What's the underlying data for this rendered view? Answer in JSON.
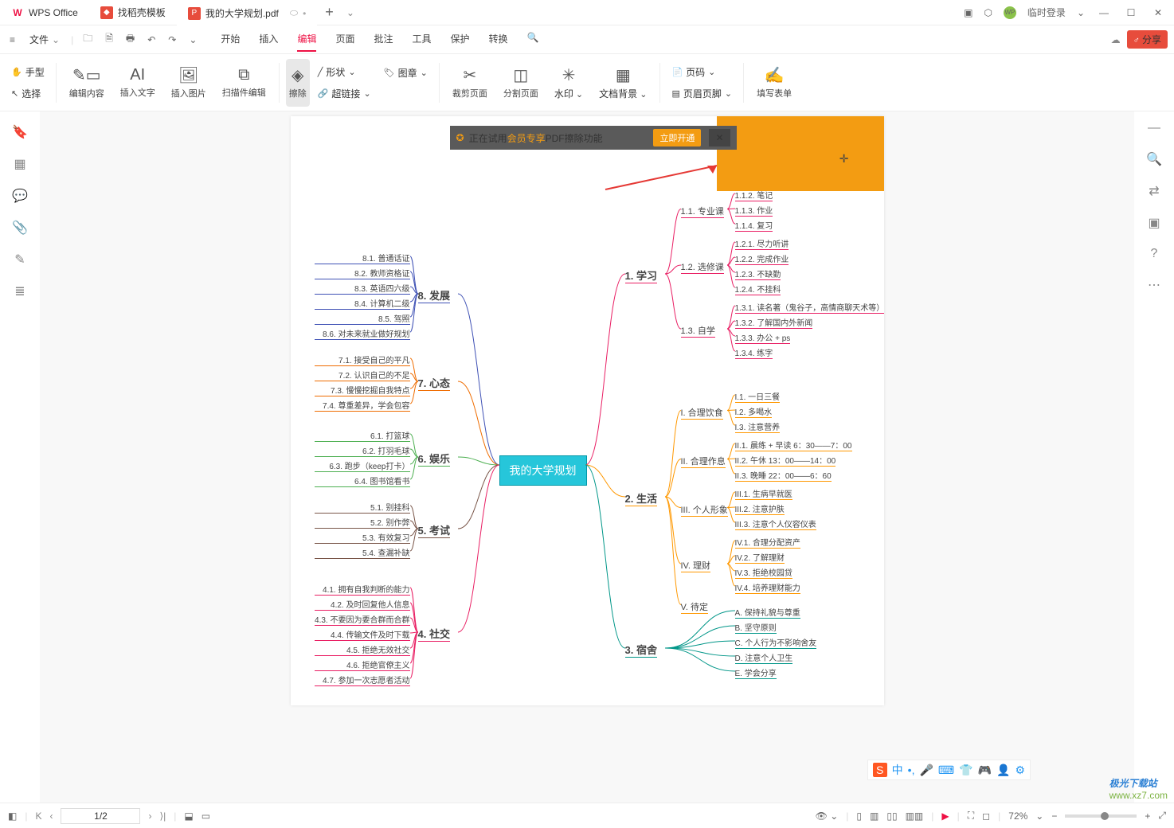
{
  "titlebar": {
    "app_name": "WPS Office",
    "tabs": [
      {
        "label": "找稻壳模板",
        "type": "template"
      },
      {
        "label": "我的大学规划.pdf",
        "type": "pdf"
      }
    ],
    "login_text": "临时登录",
    "avatar_text": "WP"
  },
  "menubar": {
    "file_label": "文件",
    "tabs": [
      "开始",
      "插入",
      "编辑",
      "页面",
      "批注",
      "工具",
      "保护",
      "转换"
    ],
    "active_tab": "编辑",
    "share_label": "分享"
  },
  "ribbon": {
    "hand": "手型",
    "select": "选择",
    "edit_content": "编辑内容",
    "insert_text": "插入文字",
    "insert_image": "插入图片",
    "scan_edit": "扫描件编辑",
    "erase": "擦除",
    "shape": "形状",
    "image": "图章",
    "hyperlink": "超链接",
    "crop_page": "裁剪页面",
    "split_page": "分割页面",
    "watermark": "水印",
    "doc_bg": "文档背景",
    "page_num": "页码",
    "header_footer": "页眉页脚",
    "fill_form": "填写表单"
  },
  "trial": {
    "prefix": "正在试用",
    "highlight": "会员专享",
    "suffix": "PDF擦除功能",
    "button": "立即开通"
  },
  "mindmap": {
    "center": "我的大学规划",
    "right": [
      {
        "label": "1. 学习",
        "children": [
          {
            "label": "1.1. 专业课",
            "leaves": [
              "1.1.2. 笔记",
              "1.1.3. 作业",
              "1.1.4. 复习"
            ]
          },
          {
            "label": "1.2. 选修课",
            "leaves": [
              "1.2.1. 尽力听讲",
              "1.2.2. 完成作业",
              "1.2.3. 不缺勤",
              "1.2.4. 不挂科"
            ]
          },
          {
            "label": "1.3. 自学",
            "leaves": [
              "1.3.1. 读名著（鬼谷子，高情商聊天术等）",
              "1.3.2. 了解国内外新闻",
              "1.3.3. 办公 + ps",
              "1.3.4. 练字"
            ]
          }
        ]
      },
      {
        "label": "2. 生活",
        "children": [
          {
            "label": "I. 合理饮食",
            "leaves": [
              "I.1. 一日三餐",
              "I.2. 多喝水",
              "I.3. 注意营养"
            ]
          },
          {
            "label": "II. 合理作息",
            "leaves": [
              "II.1. 晨练 + 早读 6：30——7：00",
              "II.2. 午休 13：00——14：00",
              "II.3. 晚睡 22：00——6：60"
            ]
          },
          {
            "label": "III. 个人形象",
            "leaves": [
              "III.1. 生病早就医",
              "III.2. 注意护肤",
              "III.3. 注意个人仪容仪表"
            ]
          },
          {
            "label": "IV. 理财",
            "leaves": [
              "IV.1. 合理分配资产",
              "IV.2. 了解理财",
              "IV.3. 拒绝校园贷",
              "IV.4. 培养理财能力"
            ]
          },
          {
            "label": "V. 待定",
            "leaves": []
          }
        ]
      },
      {
        "label": "3. 宿舍",
        "children": [
          {
            "label": "",
            "leaves": [
              "A. 保持礼貌与尊重",
              "B. 坚守原则",
              "C. 个人行为不影响舍友",
              "D. 注意个人卫生",
              "E. 学会分享"
            ]
          }
        ]
      }
    ],
    "left": [
      {
        "label": "8. 发展",
        "leaves": [
          "8.1. 普通话证",
          "8.2. 教师资格证",
          "8.3. 英语四六级",
          "8.4. 计算机二级",
          "8.5. 驾照",
          "8.6. 对未来就业做好规划"
        ]
      },
      {
        "label": "7. 心态",
        "leaves": [
          "7.1. 接受自己的平凡",
          "7.2. 认识自己的不足",
          "7.3. 慢慢挖掘自我特点",
          "7.4. 尊重差异，学会包容"
        ]
      },
      {
        "label": "6. 娱乐",
        "leaves": [
          "6.1. 打篮球",
          "6.2. 打羽毛球",
          "6.3. 跑步（keep打卡）",
          "6.4. 图书馆看书"
        ]
      },
      {
        "label": "5. 考试",
        "leaves": [
          "5.1. 别挂科",
          "5.2. 别作弊",
          "5.3. 有效复习",
          "5.4. 查漏补缺"
        ]
      },
      {
        "label": "4. 社交",
        "leaves": [
          "4.1. 拥有自我判断的能力",
          "4.2. 及时回复他人信息",
          "4.3. 不要因为要合群而合群",
          "4.4. 传输文件及时下载",
          "4.5. 拒绝无效社交",
          "4.6. 拒绝官僚主义",
          "4.7. 参加一次志愿者活动"
        ]
      }
    ]
  },
  "statusbar": {
    "page": "1/2",
    "zoom": "72%"
  },
  "ime": {
    "lang": "中"
  },
  "watermark": {
    "line1": "极光下载站",
    "line2": "www.xz7.com"
  }
}
